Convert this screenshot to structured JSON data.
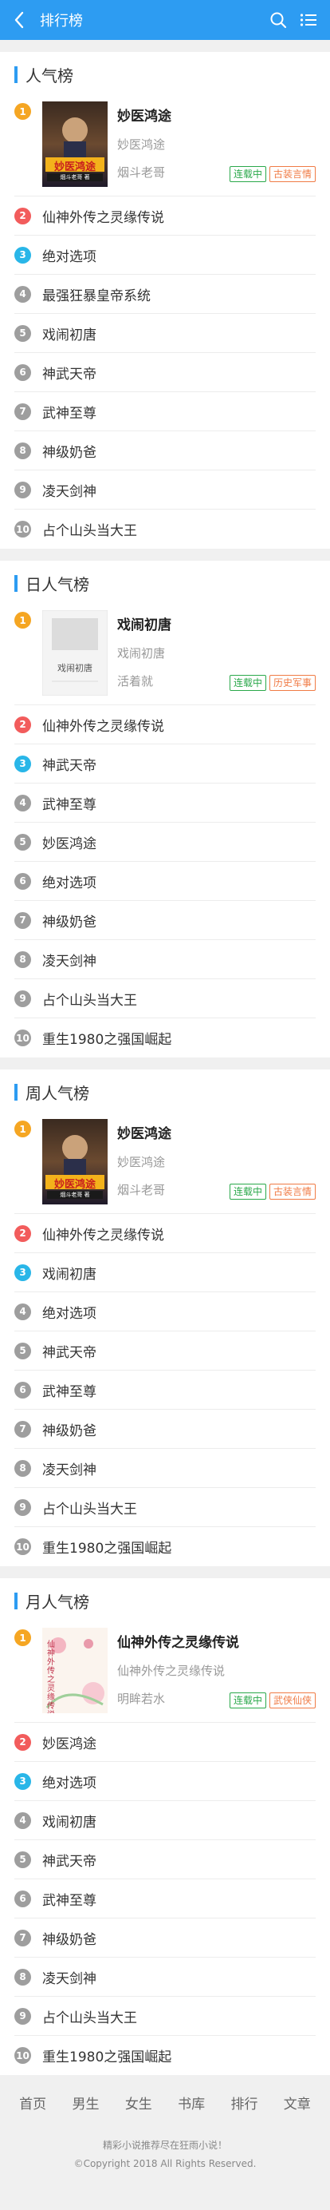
{
  "header": {
    "title": "排行榜",
    "bg_color": "#2d9cf2"
  },
  "sections": [
    {
      "title": "人气榜",
      "top": {
        "rank": "1",
        "name": "妙医鸿途",
        "sub": "妙医鸿途",
        "author": "烟斗老哥",
        "tags": [
          "连载中",
          "古装言情"
        ],
        "cover_text": "妙医鸿途",
        "cover_subtext": "烟斗老哥 著"
      },
      "items": [
        {
          "rank": "2",
          "name": "仙神外传之灵缘传说"
        },
        {
          "rank": "3",
          "name": "绝对选项"
        },
        {
          "rank": "4",
          "name": "最强狂暴皇帝系统"
        },
        {
          "rank": "5",
          "name": "戏闹初唐"
        },
        {
          "rank": "6",
          "name": "神武天帝"
        },
        {
          "rank": "7",
          "name": "武神至尊"
        },
        {
          "rank": "8",
          "name": "神级奶爸"
        },
        {
          "rank": "9",
          "name": "凌天剑神"
        },
        {
          "rank": "10",
          "name": "占个山头当大王"
        }
      ]
    },
    {
      "title": "日人气榜",
      "top": {
        "rank": "1",
        "name": "戏闹初唐",
        "sub": "戏闹初唐",
        "author": "活着就",
        "tags": [
          "连载中",
          "历史军事"
        ],
        "cover_text": "戏闹初唐",
        "cover_subtext": ""
      },
      "items": [
        {
          "rank": "2",
          "name": "仙神外传之灵缘传说"
        },
        {
          "rank": "3",
          "name": "神武天帝"
        },
        {
          "rank": "4",
          "name": "武神至尊"
        },
        {
          "rank": "5",
          "name": "妙医鸿途"
        },
        {
          "rank": "6",
          "name": "绝对选项"
        },
        {
          "rank": "7",
          "name": "神级奶爸"
        },
        {
          "rank": "8",
          "name": "凌天剑神"
        },
        {
          "rank": "9",
          "name": "占个山头当大王"
        },
        {
          "rank": "10",
          "name": "重生1980之强国崛起"
        }
      ]
    },
    {
      "title": "周人气榜",
      "top": {
        "rank": "1",
        "name": "妙医鸿途",
        "sub": "妙医鸿途",
        "author": "烟斗老哥",
        "tags": [
          "连载中",
          "古装言情"
        ],
        "cover_text": "妙医鸿途",
        "cover_subtext": "烟斗老哥 著"
      },
      "items": [
        {
          "rank": "2",
          "name": "仙神外传之灵缘传说"
        },
        {
          "rank": "3",
          "name": "戏闹初唐"
        },
        {
          "rank": "4",
          "name": "绝对选项"
        },
        {
          "rank": "5",
          "name": "神武天帝"
        },
        {
          "rank": "6",
          "name": "武神至尊"
        },
        {
          "rank": "7",
          "name": "神级奶爸"
        },
        {
          "rank": "8",
          "name": "凌天剑神"
        },
        {
          "rank": "9",
          "name": "占个山头当大王"
        },
        {
          "rank": "10",
          "name": "重生1980之强国崛起"
        }
      ]
    },
    {
      "title": "月人气榜",
      "top": {
        "rank": "1",
        "name": "仙神外传之灵缘传说",
        "sub": "仙神外传之灵缘传说",
        "author": "明眸若水",
        "tags": [
          "连载中",
          "武侠仙侠"
        ],
        "cover_text": "仙神外传之灵缘传说",
        "cover_subtext": ""
      },
      "items": [
        {
          "rank": "2",
          "name": "妙医鸿途"
        },
        {
          "rank": "3",
          "name": "绝对选项"
        },
        {
          "rank": "4",
          "name": "戏闹初唐"
        },
        {
          "rank": "5",
          "name": "神武天帝"
        },
        {
          "rank": "6",
          "name": "武神至尊"
        },
        {
          "rank": "7",
          "name": "神级奶爸"
        },
        {
          "rank": "8",
          "name": "凌天剑神"
        },
        {
          "rank": "9",
          "name": "占个山头当大王"
        },
        {
          "rank": "10",
          "name": "重生1980之强国崛起"
        }
      ]
    }
  ],
  "footer": {
    "nav": [
      "首页",
      "男生",
      "女生",
      "书库",
      "排行",
      "文章"
    ],
    "line1": "精彩小说推荐尽在狂雨小说！",
    "line2": "©Copyright 2018 All Rights Reserved."
  },
  "colors": {
    "rank1": "#f5a623",
    "rank2": "#f25c5c",
    "rank3": "#29b6e8",
    "rank_other": "#9e9e9e",
    "tag_status": "#2aa84a",
    "tag_genre": "#f07b45"
  }
}
